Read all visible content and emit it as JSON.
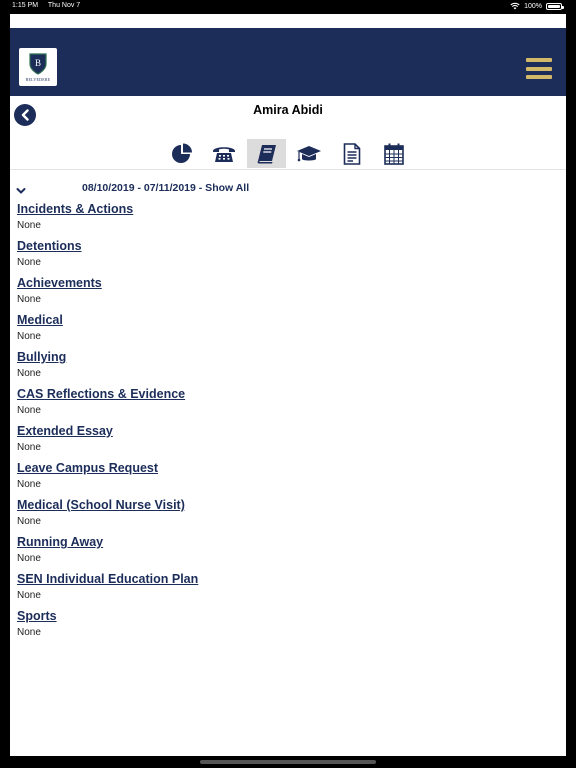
{
  "statusbar": {
    "time": "1:15 PM",
    "date": "Thu Nov 7",
    "battery": "100%",
    "battery_level": 1.0
  },
  "header": {
    "logo_text": "BELVEDERE"
  },
  "student": {
    "name": "Amira Abidi"
  },
  "tabs": [
    {
      "icon": "pie-chart-icon"
    },
    {
      "icon": "telephone-icon"
    },
    {
      "icon": "book-icon",
      "active": true
    },
    {
      "icon": "graduation-cap-icon"
    },
    {
      "icon": "document-icon"
    },
    {
      "icon": "calendar-icon"
    }
  ],
  "filter": {
    "date_range": "08/10/2019 - 07/11/2019 - Show All"
  },
  "sections": [
    {
      "title": "Incidents & Actions",
      "value": "None"
    },
    {
      "title": "Detentions",
      "value": "None"
    },
    {
      "title": "Achievements",
      "value": "None"
    },
    {
      "title": "Medical",
      "value": "None"
    },
    {
      "title": "Bullying",
      "value": "None"
    },
    {
      "title": "CAS Reflections & Evidence",
      "value": "None"
    },
    {
      "title": "Extended Essay",
      "value": "None"
    },
    {
      "title": "Leave Campus Request",
      "value": "None"
    },
    {
      "title": "Medical (School Nurse Visit)",
      "value": "None"
    },
    {
      "title": "Running Away",
      "value": "None"
    },
    {
      "title": "SEN Individual Education Plan",
      "value": "None"
    },
    {
      "title": "Sports",
      "value": "None"
    }
  ],
  "colors": {
    "navy": "#1c2d5a",
    "gold": "#d4b86a",
    "active_tab": "#dcdcdc"
  }
}
